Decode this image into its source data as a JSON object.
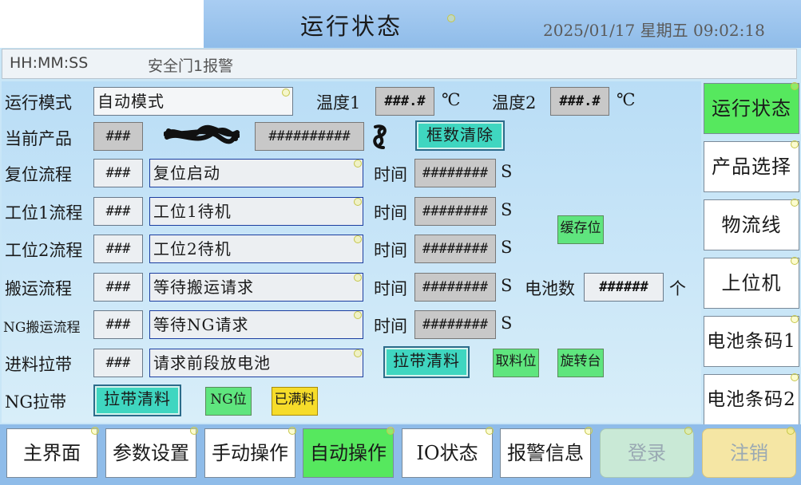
{
  "header": {
    "title": "运行状态",
    "datetime": "2025/01/17 星期五 09:02:18"
  },
  "alarm_bar": {
    "time": "HH:MM:SS",
    "message": "安全门1报警"
  },
  "rows": {
    "mode": {
      "label": "运行模式",
      "value": "自动模式"
    },
    "temp1": {
      "label": "温度1",
      "value": "###.#",
      "unit": "℃"
    },
    "temp2": {
      "label": "温度2",
      "value": "###.#",
      "unit": "℃"
    },
    "product": {
      "label": "当前产品",
      "id": "###",
      "code": "##########",
      "clear_button": "框数清除"
    },
    "reset": {
      "label": "复位流程",
      "id": "###",
      "status": "复位启动"
    },
    "station1": {
      "label": "工位1流程",
      "id": "###",
      "status": "工位1待机"
    },
    "station2": {
      "label": "工位2流程",
      "id": "###",
      "status": "工位2待机"
    },
    "transport": {
      "label": "搬运流程",
      "id": "###",
      "status": "等待搬运请求"
    },
    "ng_transport": {
      "label": "NG搬运流程",
      "id": "###",
      "status": "等待NG请求"
    },
    "feed_belt": {
      "label": "进料拉带",
      "id": "###",
      "status": "请求前段放电池",
      "clear_button": "拉带清料"
    },
    "ng_belt": {
      "label": "NG拉带",
      "clear_button": "拉带清料"
    }
  },
  "time_label": "时间",
  "time_value": "########",
  "time_unit": "S",
  "battery_count": {
    "label": "电池数",
    "value": "######",
    "unit": "个"
  },
  "indicators": {
    "cache": "缓存位",
    "pick": "取料位",
    "rotate": "旋转台",
    "ng_pos": "NG位",
    "full": "已满料"
  },
  "right_nav": [
    "运行状态",
    "产品选择",
    "物流线",
    "上位机",
    "电池条码1",
    "电池条码2"
  ],
  "bottom_nav": [
    "主界面",
    "参数设置",
    "手动操作",
    "自动操作",
    "IO状态",
    "报警信息",
    "登录",
    "注销"
  ],
  "colors": {
    "active": "#56e85e",
    "teal_button": "#3fd6c0",
    "indicator_green": "#5fe57e",
    "indicator_yellow": "#f6dc2a",
    "header_blue": "#8fbce9"
  }
}
